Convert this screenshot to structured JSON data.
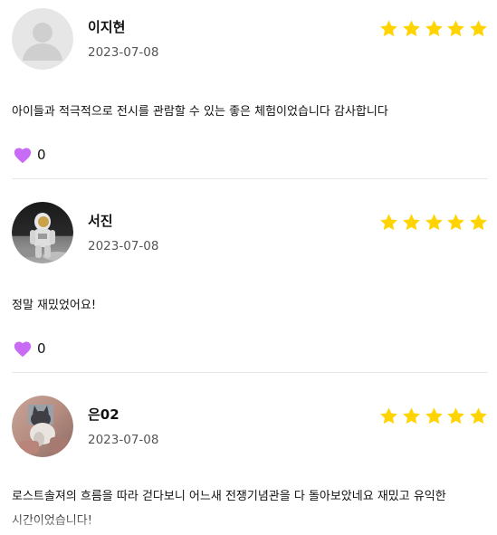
{
  "reviews": [
    {
      "name": "이지현",
      "date": "2023-07-08",
      "rating": 5,
      "avatar_icon": "default-user-icon",
      "text": "아이들과 적극적으로 전시를 관람할 수 있는 좋은 체험이었습니다 감사합니다",
      "likes": "0"
    },
    {
      "name": "서진",
      "date": "2023-07-08",
      "rating": 5,
      "avatar_icon": "astronaut-photo",
      "text": "정말 재밌었어요!",
      "likes": "0"
    },
    {
      "name": "은02",
      "date": "2023-07-08",
      "rating": 5,
      "avatar_icon": "cat-photo",
      "text": "로스트솔져의 흐름을 따라 걷다보니 어느새 전쟁기념관을 다 돌아보았네요 재밌고 유익한 시간이었습니다!",
      "likes": null
    }
  ],
  "colors": {
    "star": "#FFD400",
    "heart": "#C86BF5",
    "divider": "#E6E6E6",
    "date": "#555555"
  }
}
